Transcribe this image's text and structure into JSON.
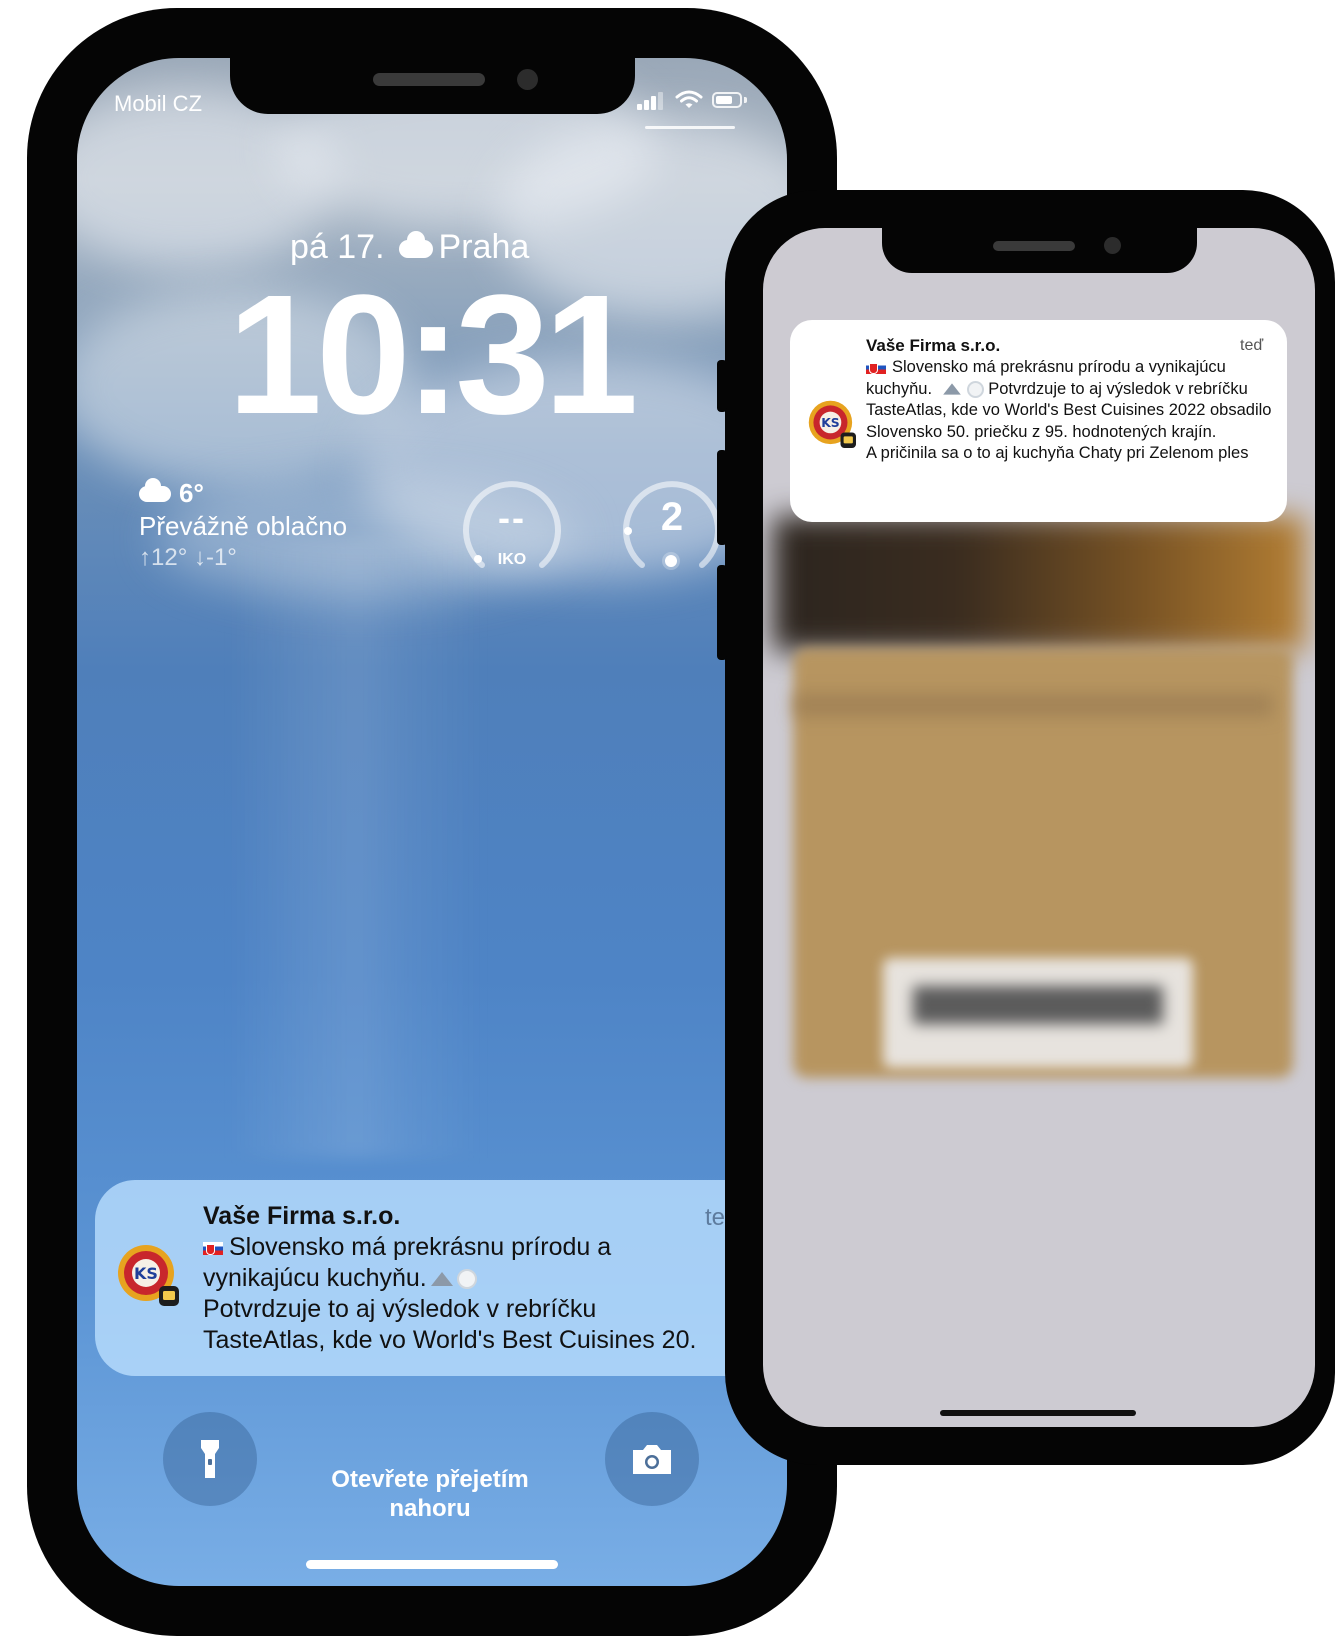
{
  "lock_screen": {
    "carrier": "Mobil CZ",
    "date": "pá 17.",
    "city": "Praha",
    "time": "10:31",
    "weather": {
      "temperature": "6°",
      "condition": "Převážně oblačno",
      "range": "↑12° ↓-1°"
    },
    "widgets": {
      "air_quality_value": "--",
      "air_quality_label": "IKO",
      "uv_value": "2"
    },
    "notification": {
      "app": "Vaše Firma s.r.o.",
      "time": "te",
      "line1": "Slovensko má prekrásnu prírodu a",
      "line2": "vynikajúcu kuchyňu.",
      "line3": "Potvrdzuje to aj výsledok v rebríčku",
      "line4": "TasteAtlas, kde vo World's Best Cuisines 20."
    },
    "swipe_hint": "Otevřete přejetím nahoru",
    "icons": [
      "flashlight-icon",
      "camera-icon"
    ]
  },
  "second_screen": {
    "notification": {
      "app": "Vaše Firma s.r.o.",
      "time": "teď",
      "line1": "Slovensko má prekrásnu prírodu a vynikajúcu kuchyňu.",
      "line2": "Potvrdzuje to aj výsledok v rebríčku TasteAtlas, kde vo World's Best Cuisines 2022 obsadilo Slovensko 50. priečku z 95. hodnotených krajín.",
      "line3": "A pričinila sa o to aj kuchyňa Chaty pri Zelenom ples"
    }
  },
  "colors": {
    "sky_top": "#9aa8b8",
    "sky_mid": "#4f7fba",
    "sky_bottom": "#79aee6",
    "notification_left_bg": "#bce0ff",
    "notification_right_bg": "#ffffff",
    "phone_frame": "#050505"
  }
}
